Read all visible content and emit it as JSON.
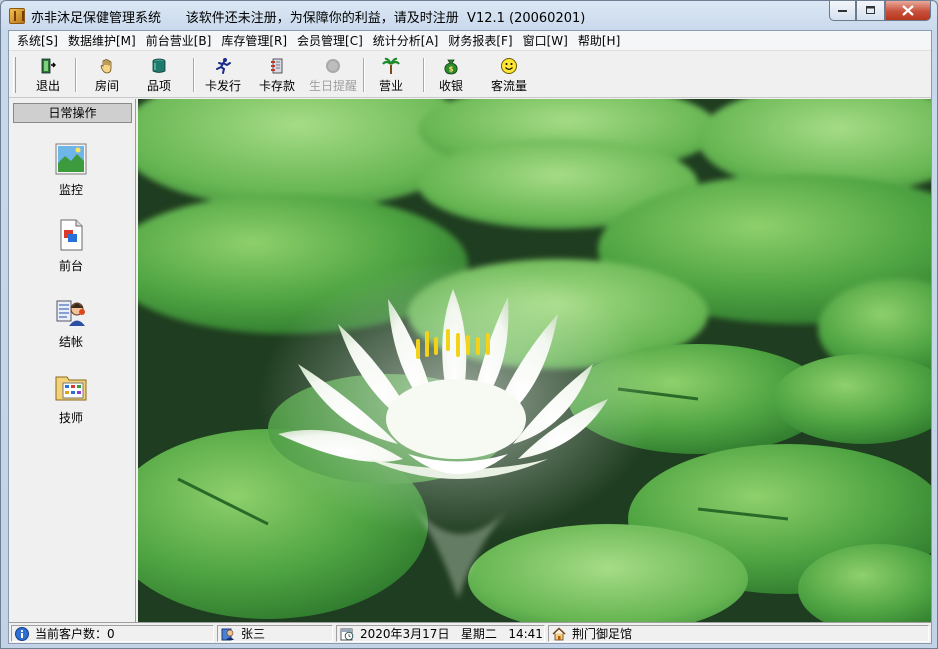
{
  "window": {
    "title": "亦非沐足保健管理系统      该软件还未注册，为保障你的利益，请及时注册  V12.1 (20060201)",
    "minimize_icon": "minimize-icon",
    "maximize_icon": "maximize-icon",
    "close_icon": "close-icon"
  },
  "menu": {
    "items": [
      "系统[S]",
      "数据维护[M]",
      "前台营业[B]",
      "库存管理[R]",
      "会员管理[C]",
      "统计分析[A]",
      "财务报表[F]",
      "窗口[W]",
      "帮助[H]"
    ]
  },
  "toolbar": {
    "buttons": [
      {
        "label": "退出",
        "icon": "exit-door-icon",
        "enabled": true
      },
      {
        "label": "房间",
        "icon": "hand-icon",
        "enabled": true
      },
      {
        "label": "品项",
        "icon": "jar-icon",
        "enabled": true
      },
      {
        "label": "卡发行",
        "icon": "runner-icon",
        "enabled": true
      },
      {
        "label": "卡存款",
        "icon": "card-deposit-icon",
        "enabled": true
      },
      {
        "label": "生日提醒",
        "icon": "birthday-icon",
        "enabled": false
      },
      {
        "label": "营业",
        "icon": "palm-tree-icon",
        "enabled": true
      },
      {
        "label": "收银",
        "icon": "money-bag-icon",
        "enabled": true
      },
      {
        "label": "客流量",
        "icon": "smiley-icon",
        "enabled": true
      }
    ]
  },
  "sidebar": {
    "header": "日常操作",
    "items": [
      {
        "label": "监控",
        "icon": "landscape-picture-icon"
      },
      {
        "label": "前台",
        "icon": "document-icon"
      },
      {
        "label": "结帐",
        "icon": "cashier-person-icon"
      },
      {
        "label": "技师",
        "icon": "calendar-folder-icon"
      }
    ]
  },
  "statusbar": {
    "customers": "当前客户数：0",
    "user": "张三",
    "datetime": "2020年3月17日   星期二   14:41",
    "shop": "荆门御足馆"
  },
  "colors": {
    "accent": "#3a7bd5",
    "leaf_green": "#3f9a3a",
    "water_dark": "#1f3f22"
  }
}
